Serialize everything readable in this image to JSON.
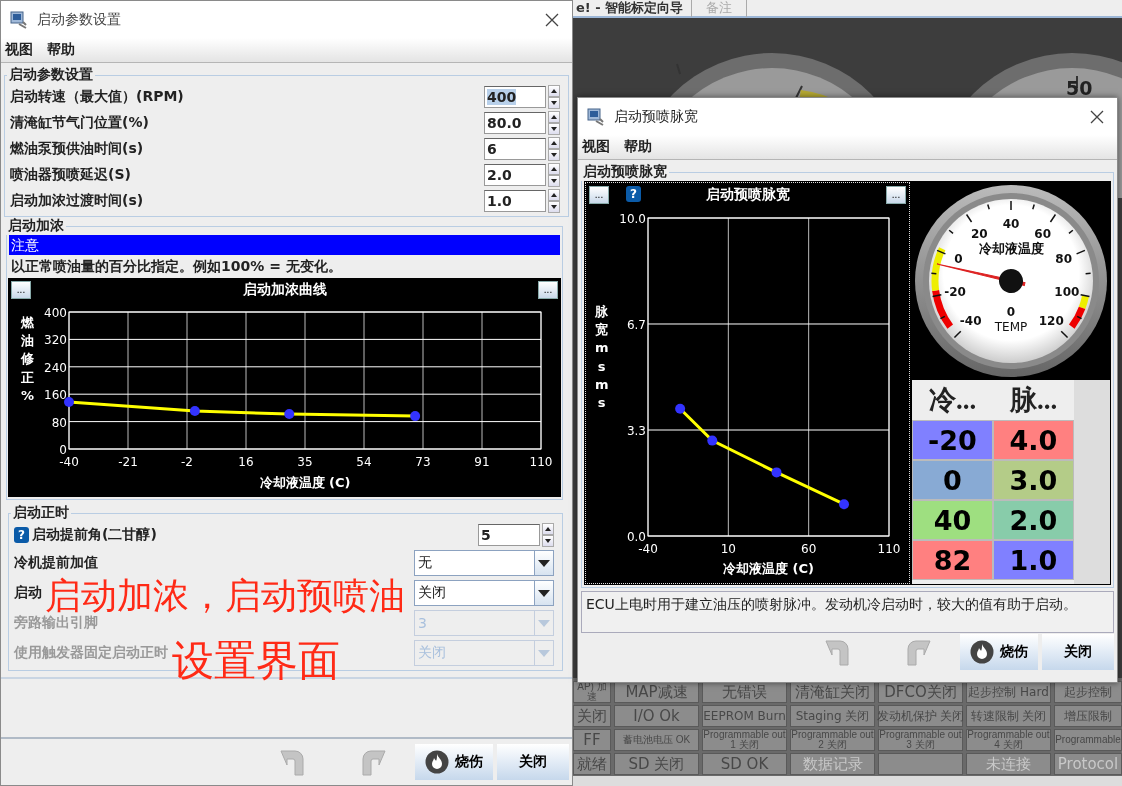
{
  "background_app": {
    "title": "e! - 智能标定向导",
    "tab": "备注",
    "gauge_readings": [
      "50"
    ],
    "status_grid": [
      [
        {
          "text": "AP) 加速",
          "kind": "tiny",
          "disabled": false
        },
        {
          "text": "MAP减速",
          "kind": "large",
          "disabled": false
        },
        {
          "text": "无错误",
          "kind": "large",
          "disabled": false
        },
        {
          "text": "清淹缸关闭",
          "kind": "large",
          "disabled": false
        },
        {
          "text": "DFCO关闭",
          "kind": "large",
          "disabled": false
        },
        {
          "text": "起步控制 Hard",
          "kind": "medium",
          "disabled": false
        },
        {
          "text": "起步控制",
          "kind": "medium",
          "disabled": false
        }
      ],
      [
        {
          "text": "关闭",
          "kind": "large",
          "disabled": false
        },
        {
          "text": "I/O Ok",
          "kind": "large",
          "disabled": false
        },
        {
          "text": "EEPROM Burn",
          "kind": "medium",
          "disabled": false
        },
        {
          "text": "Staging 关闭",
          "kind": "medium",
          "disabled": false
        },
        {
          "text": "发动机保护 关闭",
          "kind": "medium",
          "disabled": false
        },
        {
          "text": "转速限制 关闭",
          "kind": "medium",
          "disabled": false
        },
        {
          "text": "增压限制",
          "kind": "medium",
          "disabled": false
        }
      ],
      [
        {
          "text": "FF",
          "kind": "large",
          "disabled": false
        },
        {
          "text": "蓄电池电压 OK",
          "kind": "small",
          "disabled": false
        },
        {
          "text": "Programmable out 1 关闭",
          "kind": "small",
          "disabled": false
        },
        {
          "text": "Programmable out 2 关闭",
          "kind": "small",
          "disabled": false
        },
        {
          "text": "Programmable out 3 关闭",
          "kind": "small",
          "disabled": false
        },
        {
          "text": "Programmable out 4 关闭",
          "kind": "small",
          "disabled": false
        },
        {
          "text": "Programmable",
          "kind": "small",
          "disabled": false
        }
      ],
      [
        {
          "text": "就绪",
          "kind": "large",
          "disabled": false
        },
        {
          "text": "SD 关闭",
          "kind": "large",
          "disabled": false
        },
        {
          "text": "SD OK",
          "kind": "large",
          "disabled": false
        },
        {
          "text": "数据记录",
          "kind": "large",
          "disabled": true
        },
        {
          "kind": "blank"
        },
        {
          "text": "未连接",
          "kind": "large",
          "disabled": true
        },
        {
          "text": "Protocol",
          "kind": "large",
          "disabled": true
        }
      ]
    ]
  },
  "start_window": {
    "title": "启动参数设置",
    "menu": [
      "视图",
      "帮助"
    ],
    "params": {
      "legend": "启动参数设置",
      "rows": [
        {
          "label": "启动转速（最大值）(RPM)",
          "value": "400",
          "selected": true
        },
        {
          "label": "清淹缸节气门位置(%)",
          "value": "80.0",
          "selected": false
        },
        {
          "label": "燃油泵预供油时间(s)",
          "value": "6",
          "selected": false
        },
        {
          "label": "喷油器预喷延迟(S)",
          "value": "2.0",
          "selected": false
        },
        {
          "label": "启动加浓过渡时间(s)",
          "value": "1.0",
          "selected": false
        }
      ]
    },
    "enrich": {
      "legend": "启动加浓",
      "note_title": "注意",
      "note": "以正常喷油量的百分比指定。例如100% = 无变化。",
      "chart_buttons": [
        "...",
        "..."
      ],
      "chart_data": {
        "type": "line",
        "title": "启动加浓曲线",
        "xlabel": "冷却液温度 (C)",
        "ylabel": "燃油修正 %",
        "x": [
          -40,
          0,
          30,
          70
        ],
        "grid": true,
        "series": [
          {
            "color": "#ffff00",
            "marker": "o",
            "values": [
              137,
              111,
              102,
              96
            ]
          }
        ],
        "xlim": [
          -40,
          110
        ],
        "ylim": [
          0,
          400
        ],
        "xticks": [
          -40,
          {
            "value": -21.25,
            "label": "-21"
          },
          {
            "value": -2.5,
            "label": "-2"
          },
          {
            "value": 16.25,
            "label": "16"
          },
          35,
          {
            "value": 53.75,
            "label": "54"
          },
          {
            "value": 72.5,
            "label": "73"
          },
          {
            "value": 91.25,
            "label": "91"
          },
          110
        ],
        "yticks": [
          0,
          80,
          160,
          240,
          320,
          400
        ]
      }
    },
    "timing": {
      "legend": "启动正时",
      "spinner": {
        "help": "?",
        "label": "启动提前角(二甘醇)",
        "value": "5"
      },
      "combos": [
        {
          "label": "冷机提前加值",
          "value": "无",
          "disabled": false
        },
        {
          "label": "启动",
          "value": "关闭",
          "disabled": false
        },
        {
          "label": "旁路输出引脚",
          "value": "3",
          "disabled": true
        },
        {
          "label": "使用触发器固定启动正时",
          "value": "关闭",
          "disabled": true
        }
      ]
    },
    "buttons": [
      {
        "kind": "undo",
        "disabled": true
      },
      {
        "kind": "redo",
        "disabled": true
      },
      {
        "kind": "burn",
        "label": "烧伤",
        "disabled": false
      },
      {
        "kind": "close",
        "label": "关闭",
        "disabled": false
      }
    ]
  },
  "prime_window": {
    "title": "启动预喷脉宽",
    "menu": [
      "视图",
      "帮助"
    ],
    "legend": "启动预喷脉宽",
    "chart_buttons": [
      "...",
      "..."
    ],
    "help": "?",
    "chart_data": {
      "type": "line",
      "title": "启动预喷脉宽",
      "xlabel": "冷却液温度 (C)",
      "ylabel": "脉宽ms ms",
      "x": [
        -20,
        0,
        40,
        82
      ],
      "grid": true,
      "series": [
        {
          "color": "#ffff00",
          "marker": "o",
          "values": [
            4.0,
            3.0,
            2.0,
            1.0
          ]
        }
      ],
      "xlim": [
        -40,
        110
      ],
      "ylim": [
        0,
        10
      ],
      "xticks": [
        -40,
        10,
        60,
        110
      ],
      "yticks": [
        {
          "value": 0,
          "label": "0.0"
        },
        {
          "value": 3.333,
          "label": "3.3"
        },
        {
          "value": 6.667,
          "label": "6.7"
        },
        {
          "value": 10,
          "label": "10.0"
        }
      ]
    },
    "gauge": {
      "title": "冷却液温度",
      "ticks": [
        "-40",
        "-20",
        "0",
        "20",
        "40",
        "60",
        "80",
        "100",
        "120"
      ],
      "reading": "0",
      "units": "TEMP"
    },
    "table": {
      "columns": [
        "冷...",
        "脉..."
      ],
      "rows": [
        [
          {
            "text": "-20",
            "color": "#8080ff"
          },
          {
            "text": "4.0",
            "color": "#ff8080"
          }
        ],
        [
          {
            "text": "0",
            "color": "#88aad4"
          },
          {
            "text": "3.0",
            "color": "#b4cc88"
          }
        ],
        [
          {
            "text": "40",
            "color": "#9edf80"
          },
          {
            "text": "2.0",
            "color": "#88ccaa"
          }
        ],
        [
          {
            "text": "82",
            "color": "#ff8080"
          },
          {
            "text": "1.0",
            "color": "#8080ff"
          }
        ]
      ]
    },
    "description": "ECU上电时用于建立油压的喷射脉冲。发动机冷启动时，较大的值有助于启动。",
    "buttons": [
      {
        "kind": "undo",
        "disabled": true
      },
      {
        "kind": "redo",
        "disabled": true
      },
      {
        "kind": "burn",
        "label": "烧伤",
        "disabled": false
      },
      {
        "kind": "close",
        "label": "关闭",
        "disabled": false
      }
    ]
  },
  "annotation": [
    "启动加浓，启动预喷油",
    "设置界面"
  ]
}
